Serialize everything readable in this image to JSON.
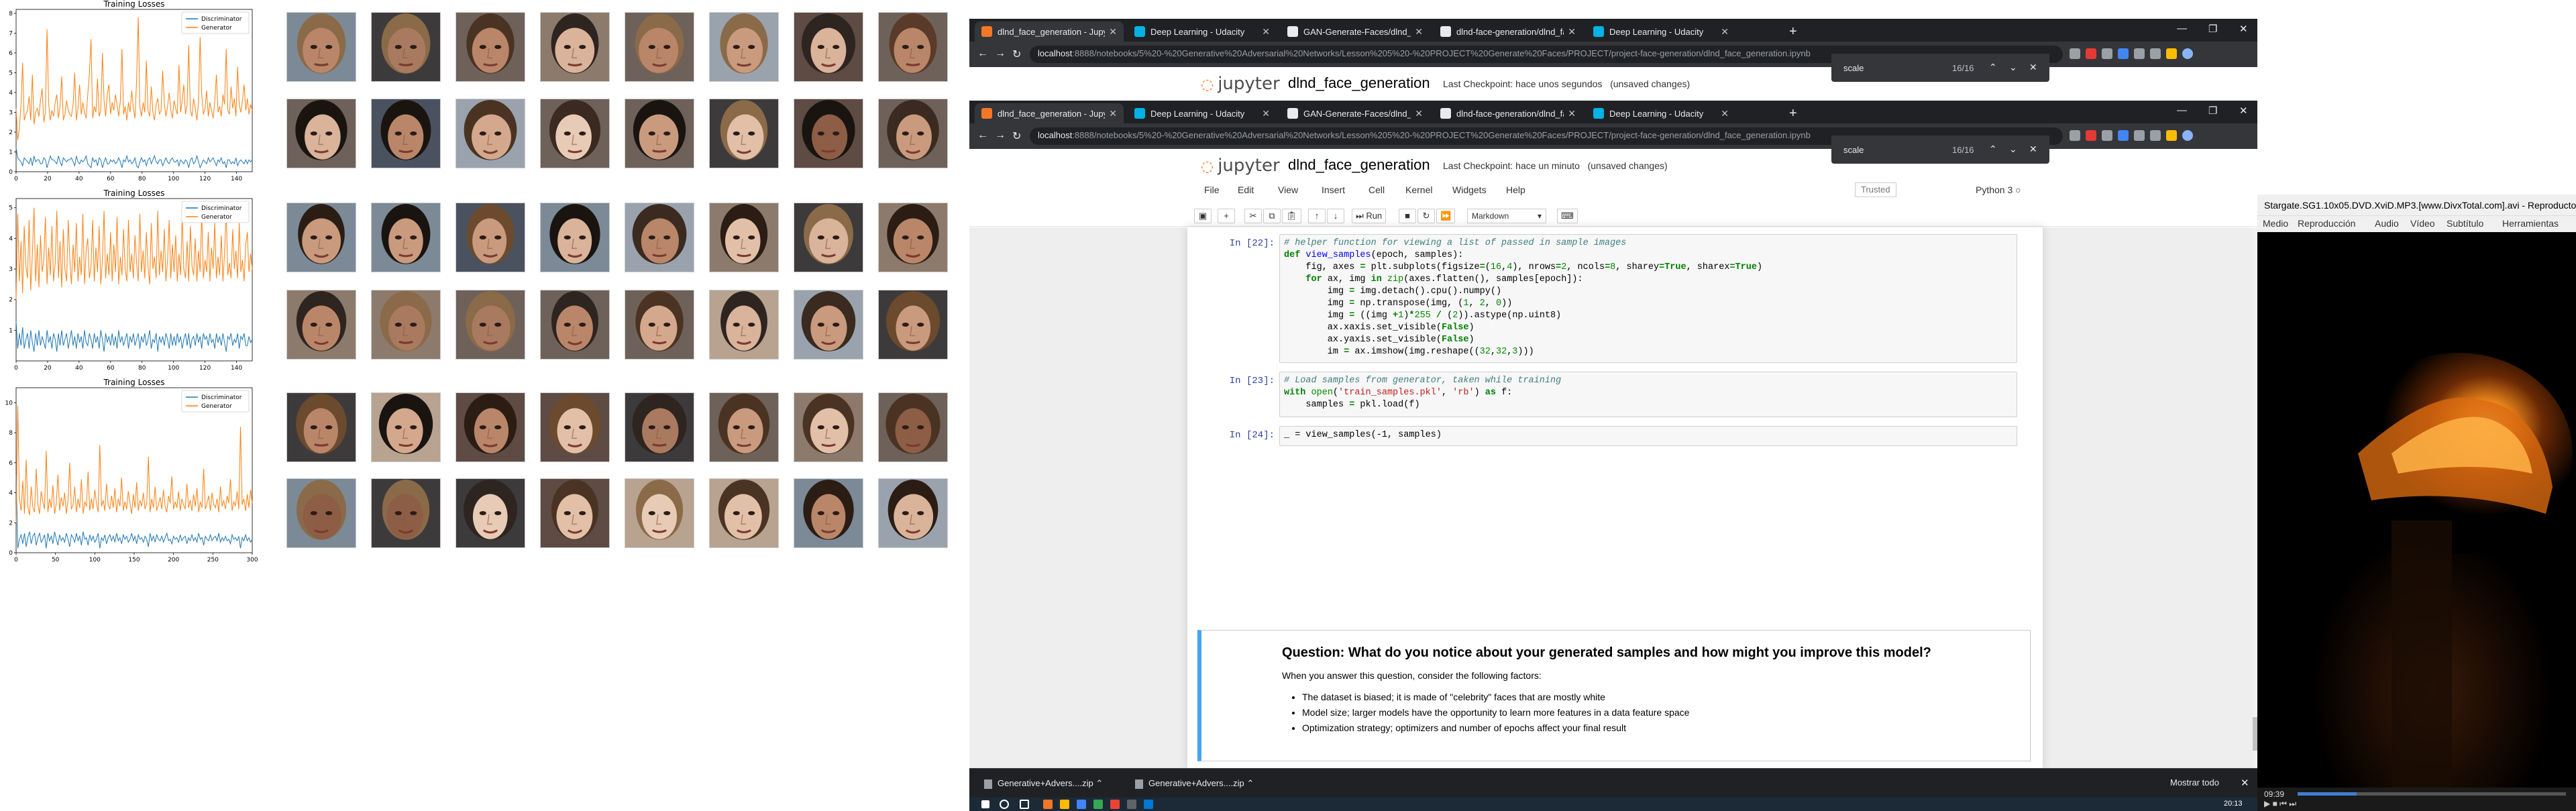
{
  "loss_charts": [
    {
      "title": "Training Losses",
      "legend": [
        "Discriminator",
        "Generator"
      ],
      "legend_position": "top-right",
      "xlim": [
        0,
        150
      ],
      "ylim": [
        0,
        8.2
      ],
      "xticks": [
        0,
        20,
        40,
        60,
        80,
        100,
        120,
        140
      ],
      "yticks": [
        0,
        1,
        2,
        3,
        4,
        5,
        6,
        7,
        8
      ],
      "generator": [
        3.2,
        1.6,
        2.2,
        3.4,
        5.5,
        2.6,
        2.9,
        3.1,
        3.8,
        2.6,
        4.9,
        2.4,
        3.0,
        3.2,
        2.8,
        3.6,
        4.2,
        2.5,
        3.0,
        7.2,
        3.4,
        2.6,
        3.1,
        2.8,
        3.5,
        3.9,
        2.7,
        3.3,
        4.8,
        2.6,
        2.9,
        3.6,
        3.1,
        2.9,
        2.8,
        3.4,
        5.0,
        2.6,
        3.2,
        4.4,
        2.9,
        3.5,
        3.0,
        2.7,
        3.9,
        4.9,
        6.7,
        2.7,
        3.3,
        3.0,
        4.7,
        2.8,
        3.1,
        6.0,
        3.6,
        2.8,
        3.9,
        4.4,
        2.9,
        3.5,
        3.1,
        3.9,
        3.4,
        2.8,
        3.6,
        6.2,
        2.9,
        3.3,
        2.6,
        3.5,
        3.0,
        4.1,
        3.2,
        2.7,
        4.6,
        7.8,
        3.3,
        2.8,
        3.5,
        3.0,
        5.6,
        3.1,
        2.8,
        4.3,
        3.0,
        2.6,
        3.4,
        3.7,
        2.9,
        3.1,
        5.1,
        3.5,
        2.8,
        3.3,
        4.0,
        3.1,
        2.7,
        3.6,
        3.2,
        2.9,
        5.4,
        3.0,
        3.6,
        4.4,
        2.9,
        3.4,
        6.4,
        3.1,
        2.8,
        3.7,
        3.2,
        2.6,
        3.5,
        6.8,
        3.9,
        2.9,
        3.2,
        4.1,
        2.8,
        3.5,
        3.1,
        2.7,
        3.6,
        4.9,
        3.0,
        3.3,
        2.8,
        3.9,
        3.4,
        6.2,
        3.1,
        2.9,
        4.3,
        3.2,
        3.7,
        2.8,
        5.3,
        3.4,
        3.0,
        3.6,
        4.4,
        3.1,
        3.7,
        2.9,
        3.4,
        3.1
      ],
      "discriminator": [
        1.2,
        0.7,
        0.6,
        0.5,
        0.3,
        0.7,
        0.6,
        0.5,
        0.4,
        0.7,
        0.3,
        0.8,
        0.5,
        0.6,
        0.6,
        0.4,
        0.4,
        0.7,
        0.6,
        0.2,
        0.5,
        0.8,
        0.6,
        0.6,
        0.5,
        0.4,
        0.8,
        0.5,
        0.3,
        0.7,
        0.6,
        0.5,
        0.6,
        0.6,
        0.7,
        0.5,
        0.3,
        0.8,
        0.5,
        0.4,
        0.6,
        0.5,
        0.6,
        0.8,
        0.4,
        0.3,
        0.2,
        0.7,
        0.5,
        0.6,
        0.3,
        0.7,
        0.6,
        0.2,
        0.5,
        0.7,
        0.4,
        0.4,
        0.6,
        0.5,
        0.6,
        0.4,
        0.5,
        0.7,
        0.5,
        0.2,
        0.6,
        0.5,
        0.8,
        0.5,
        0.6,
        0.4,
        0.5,
        0.7,
        0.3,
        0.2,
        0.5,
        0.7,
        0.5,
        0.6,
        0.3,
        0.6,
        0.7,
        0.4,
        0.6,
        0.8,
        0.5,
        0.4,
        0.6,
        0.6,
        0.3,
        0.5,
        0.7,
        0.5,
        0.4,
        0.6,
        0.7,
        0.5,
        0.5,
        0.6,
        0.3,
        0.6,
        0.5,
        0.4,
        0.6,
        0.5,
        0.2,
        0.6,
        0.7,
        0.4,
        0.5,
        0.8,
        0.5,
        0.2,
        0.4,
        0.6,
        0.5,
        0.4,
        0.7,
        0.5,
        0.6,
        0.7,
        0.5,
        0.3,
        0.6,
        0.5,
        0.7,
        0.4,
        0.5,
        0.2,
        0.6,
        0.6,
        0.4,
        0.5,
        0.4,
        0.7,
        0.3,
        0.5,
        0.6,
        0.5,
        0.4,
        0.6,
        0.4,
        0.6,
        0.5,
        0.6
      ]
    },
    {
      "title": "Training Losses",
      "legend": [
        "Discriminator",
        "Generator"
      ],
      "legend_position": "top-right",
      "xlim": [
        0,
        150
      ],
      "ylim": [
        0,
        5.3
      ],
      "xticks": [
        0,
        20,
        40,
        60,
        80,
        100,
        120,
        140
      ],
      "yticks": [
        1,
        2,
        3,
        4,
        5
      ],
      "generator": [
        2.0,
        4.8,
        2.6,
        3.9,
        2.2,
        4.4,
        3.1,
        2.7,
        4.6,
        2.3,
        3.5,
        5.0,
        2.6,
        3.8,
        2.4,
        4.1,
        2.9,
        3.3,
        4.7,
        2.5,
        3.7,
        2.8,
        4.4,
        2.6,
        3.2,
        4.9,
        2.7,
        3.9,
        2.4,
        4.3,
        3.0,
        2.6,
        4.6,
        3.3,
        2.5,
        3.8,
        2.9,
        4.5,
        2.6,
        3.4,
        2.8,
        4.8,
        2.5,
        3.6,
        4.0,
        2.7,
        3.1,
        4.6,
        2.6,
        3.7,
        2.9,
        4.4,
        2.5,
        3.3,
        4.9,
        2.7,
        3.5,
        2.8,
        4.2,
        2.6,
        3.8,
        2.9,
        4.7,
        2.5,
        3.4,
        2.8,
        4.3,
        3.0,
        2.6,
        4.6,
        2.9,
        3.5,
        2.7,
        4.1,
        3.2,
        2.6,
        4.8,
        2.9,
        3.6,
        2.7,
        4.2,
        3.1,
        2.5,
        4.5,
        3.0,
        3.4,
        2.7,
        4.9,
        2.8,
        3.6,
        2.9,
        4.3,
        2.6,
        3.3,
        4.6,
        2.7,
        3.8,
        2.9,
        4.1,
        2.6,
        3.5,
        2.8,
        4.7,
        3.0,
        2.7,
        3.9,
        2.6,
        4.4,
        3.1,
        2.8,
        4.0,
        2.6,
        3.6,
        2.9,
        4.8,
        2.7,
        3.3,
        2.9,
        4.2,
        2.6,
        3.7,
        3.0,
        4.5,
        2.7,
        3.4,
        2.8,
        4.1,
        2.6,
        3.5,
        4.9,
        2.8,
        3.2,
        2.7,
        4.3,
        3.0,
        3.6,
        2.7,
        4.5,
        2.9,
        3.3,
        2.6,
        3.8,
        4.2,
        2.9,
        3.5,
        3.0
      ],
      "discriminator": [
        1.3,
        0.4,
        0.9,
        0.5,
        1.1,
        0.4,
        0.7,
        0.9,
        0.4,
        1.0,
        0.6,
        0.3,
        0.9,
        0.5,
        1.0,
        0.5,
        0.8,
        0.6,
        0.4,
        1.0,
        0.6,
        0.8,
        0.4,
        0.9,
        0.7,
        0.3,
        0.9,
        0.5,
        1.0,
        0.5,
        0.7,
        0.9,
        0.4,
        0.7,
        1.0,
        0.5,
        0.8,
        0.4,
        0.9,
        0.6,
        0.8,
        0.4,
        1.0,
        0.6,
        0.5,
        0.9,
        0.7,
        0.4,
        0.9,
        0.6,
        0.8,
        0.4,
        1.0,
        0.7,
        0.3,
        0.9,
        0.6,
        0.8,
        0.5,
        0.9,
        0.5,
        0.8,
        0.4,
        1.0,
        0.6,
        0.8,
        0.5,
        0.7,
        0.9,
        0.4,
        0.8,
        0.6,
        0.9,
        0.5,
        0.7,
        0.9,
        0.4,
        0.8,
        0.6,
        0.9,
        0.5,
        0.7,
        1.0,
        0.4,
        0.7,
        0.6,
        0.9,
        0.3,
        0.8,
        0.6,
        0.8,
        0.5,
        0.9,
        0.7,
        0.4,
        0.9,
        0.5,
        0.8,
        0.5,
        0.9,
        0.6,
        0.8,
        0.4,
        0.7,
        0.9,
        0.5,
        0.9,
        0.4,
        0.7,
        0.8,
        0.5,
        0.9,
        0.6,
        0.8,
        0.4,
        0.9,
        0.7,
        0.8,
        0.5,
        0.9,
        0.6,
        0.7,
        0.4,
        0.9,
        0.6,
        0.8,
        0.5,
        0.9,
        0.6,
        0.3,
        0.8,
        0.7,
        0.9,
        0.5,
        0.7,
        0.6,
        0.9,
        0.4,
        0.8,
        0.7,
        0.9,
        0.5,
        0.5,
        0.8,
        0.6,
        0.7
      ]
    },
    {
      "title": "Training Losses",
      "legend": [
        "Discriminator",
        "Generator"
      ],
      "legend_position": "top-right",
      "xlim": [
        0,
        300
      ],
      "ylim": [
        0,
        11
      ],
      "xticks": [
        0,
        50,
        100,
        150,
        200,
        250,
        300
      ],
      "yticks": [
        0,
        2,
        4,
        6,
        8,
        10
      ],
      "generator": [
        2.0,
        9.8,
        3.6,
        2.8,
        4.8,
        2.6,
        6.2,
        3.1,
        2.5,
        4.4,
        3.0,
        2.7,
        5.6,
        3.2,
        2.6,
        4.1,
        3.4,
        2.9,
        6.8,
        2.7,
        3.6,
        3.0,
        4.5,
        2.6,
        3.3,
        5.2,
        2.8,
        3.7,
        3.1,
        4.0,
        2.6,
        3.5,
        6.0,
        2.9,
        3.2,
        4.4,
        2.7,
        3.6,
        3.0,
        4.9,
        2.6,
        3.4,
        3.1,
        5.4,
        2.8,
        3.6,
        2.9,
        4.2,
        3.3,
        2.7,
        7.2,
        3.1,
        3.5,
        2.8,
        4.6,
        3.2,
        2.9,
        3.8,
        3.0,
        4.3,
        2.7,
        3.6,
        3.1,
        5.0,
        2.8,
        3.4,
        2.9,
        4.1,
        3.3,
        2.6,
        3.9,
        3.0,
        4.7,
        2.8,
        3.5,
        3.1,
        4.0,
        2.9,
        3.3,
        6.4,
        2.7,
        3.6,
        3.0,
        4.4,
        2.8,
        3.2,
        3.7,
        2.9,
        4.2,
        3.1,
        2.7,
        3.8,
        3.3,
        5.1,
        2.9,
        3.4,
        3.0,
        4.1,
        2.8,
        3.6,
        3.2,
        2.9,
        4.6,
        3.0,
        3.5,
        2.8,
        3.9,
        3.1,
        4.3,
        2.7,
        3.4,
        3.0,
        5.6,
        2.9,
        3.3,
        3.8,
        2.8,
        4.0,
        3.2,
        3.0,
        3.6,
        2.7,
        4.4,
        3.1,
        3.5,
        2.9,
        3.8,
        3.3,
        4.9,
        2.8,
        3.4,
        3.1,
        4.1,
        2.9,
        8.4,
        3.2,
        3.6,
        2.8,
        3.9,
        3.0,
        4.2,
        3.3
      ],
      "discriminator": [
        5.2,
        0.3,
        0.9,
        1.2,
        0.6,
        1.3,
        0.4,
        1.0,
        1.4,
        0.6,
        1.1,
        1.3,
        0.5,
        1.0,
        1.3,
        0.7,
        0.9,
        1.2,
        0.3,
        1.3,
        0.8,
        1.1,
        0.6,
        1.4,
        0.9,
        0.5,
        1.2,
        0.8,
        1.0,
        0.7,
        1.3,
        0.9,
        0.4,
        1.2,
        1.0,
        0.7,
        1.3,
        0.8,
        1.1,
        0.5,
        1.4,
        0.9,
        1.0,
        0.5,
        1.2,
        0.8,
        1.1,
        0.7,
        0.9,
        1.3,
        0.3,
        1.0,
        0.8,
        1.2,
        0.6,
        1.0,
        1.2,
        0.8,
        1.1,
        0.7,
        1.3,
        0.8,
        1.0,
        0.6,
        1.2,
        0.9,
        1.1,
        0.7,
        0.9,
        1.3,
        0.8,
        1.1,
        0.6,
        1.2,
        0.9,
        1.0,
        0.7,
        1.1,
        0.9,
        0.4,
        1.3,
        0.8,
        1.1,
        0.7,
        1.2,
        0.9,
        0.8,
        1.1,
        0.7,
        1.0,
        1.3,
        0.8,
        0.9,
        0.6,
        1.1,
        0.9,
        1.0,
        0.7,
        1.2,
        0.8,
        1.0,
        1.1,
        0.6,
        1.0,
        0.8,
        1.2,
        0.8,
        1.0,
        0.7,
        1.3,
        0.9,
        1.0,
        0.5,
        1.1,
        0.9,
        0.8,
        1.2,
        0.8,
        1.0,
        1.1,
        0.8,
        1.3,
        0.7,
        1.0,
        0.8,
        1.1,
        0.8,
        0.9,
        0.6,
        1.2,
        0.9,
        1.0,
        0.8,
        1.1,
        0.3,
        1.0,
        0.8,
        1.2,
        0.8,
        1.0,
        0.7,
        0.9
      ]
    }
  ],
  "browser_tabs": [
    {
      "title": "dlnd_face_generation - Jupyter N",
      "active": true,
      "icon_color": "#f37726"
    },
    {
      "title": "Deep Learning - Udacity",
      "active": false,
      "icon_color": "#02b3e4"
    },
    {
      "title": "GAN-Generate-Faces/dlnd_face...",
      "active": false,
      "icon_color": "#e8eaed"
    },
    {
      "title": "dlnd-face-generation/dlnd_face...",
      "active": false,
      "icon_color": "#e8eaed"
    },
    {
      "title": "Deep Learning - Udacity",
      "active": false,
      "icon_color": "#02b3e4"
    }
  ],
  "browser_back": {
    "url_host": "localhost",
    "url_path": ":8888/notebooks/5%20-%20Generative%20Adversarial%20Networks/Lesson%205%20-%20PROJECT%20Generate%20Faces/PROJECT/project-face-generation/dlnd_face_generation.ipynb",
    "checkpoint": "Last Checkpoint: hace unos segundos",
    "unsaved": "(unsaved changes)"
  },
  "browser_front": {
    "url_host": "localhost",
    "url_path": ":8888/notebooks/5%20-%20Generative%20Adversarial%20Networks/Lesson%205%20-%20PROJECT%20Generate%20Faces/PROJECT/project-face-generation/dlnd_face_generation.ipynb",
    "checkpoint": "Last Checkpoint: hace un minuto",
    "unsaved": "(unsaved changes)"
  },
  "jupyter": {
    "logo": "jupyter",
    "notebook_name": "dlnd_face_generation",
    "find_query": "scale",
    "find_count": "16/16",
    "menus": [
      "File",
      "Edit",
      "View",
      "Insert",
      "Cell",
      "Kernel",
      "Widgets",
      "Help"
    ],
    "trusted": "Trusted",
    "kernel": "Python 3",
    "run_label": "Run",
    "cell_type": "Markdown"
  },
  "cells": [
    {
      "prompt": "In [22]:"
    },
    {
      "prompt": "In [23]:"
    },
    {
      "prompt": "In [24]:",
      "code": "_ = view_samples(-1, samples)"
    }
  ],
  "markdown": {
    "heading": "Question: What do you notice about your generated samples and how might you improve this model?",
    "intro": "When you answer this question, consider the following factors:",
    "bullets": [
      "The dataset is biased; it is made of \"celebrity\" faces that are mostly white",
      "Model size; larger models have the opportunity to learn more features in a data feature space",
      "Optimization strategy; optimizers and number of epochs affect your final result"
    ]
  },
  "downloads": {
    "items": [
      "Generative+Advers....zip",
      "Generative+Advers....zip"
    ],
    "show_all": "Mostrar todo"
  },
  "taskbar": {
    "clock": "20:13"
  },
  "player": {
    "title": "Stargate.SG1.10x05.DVD.XviD.MP3.[www.DivxTotal.com].avi - Reproductor",
    "menus": [
      "Medio",
      "Reproducción",
      "Audio",
      "Vídeo",
      "Subtítulo",
      "Herramientas"
    ],
    "time": "09:39",
    "progress": 0.22
  }
}
